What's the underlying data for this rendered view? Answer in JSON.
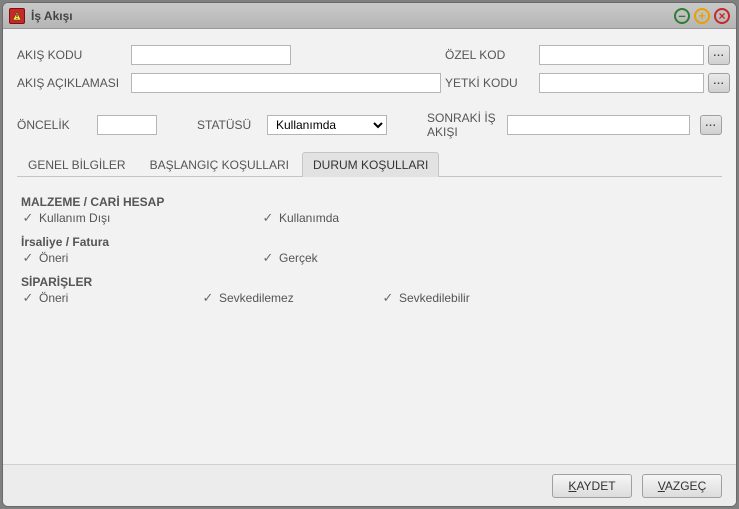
{
  "window": {
    "title": "İş Akışı"
  },
  "fields": {
    "akis_kodu_label": "AKIŞ KODU",
    "akis_kodu_value": "",
    "akis_aciklamasi_label": "AKIŞ AÇIKLAMASI",
    "akis_aciklamasi_value": "",
    "ozel_kod_label": "ÖZEL KOD",
    "ozel_kod_value": "",
    "yetki_kodu_label": "YETKİ KODU",
    "yetki_kodu_value": "",
    "oncelik_label": "ÖNCELİK",
    "oncelik_value": "",
    "statusu_label": "STATÜSÜ",
    "statusu_selected": "Kullanımda",
    "sonraki_label": "SONRAKİ İŞ AKIŞI",
    "sonraki_value": ""
  },
  "tabs": {
    "t0": "GENEL BİLGİLER",
    "t1": "BAŞLANGIÇ KOŞULLARI",
    "t2": "DURUM KOŞULLARI"
  },
  "groups": {
    "malzeme": {
      "title": "MALZEME / CARİ HESAP",
      "kullanim_disi": "Kullanım Dışı",
      "kullanimda": "Kullanımda"
    },
    "irsaliye": {
      "title": "İrsaliye / Fatura",
      "oneri": "Öneri",
      "gercek": "Gerçek"
    },
    "siparisler": {
      "title": "SİPARİŞLER",
      "oneri": "Öneri",
      "sevkedilemez": "Sevkedilemez",
      "sevkedilebilir": "Sevkedilebilir"
    }
  },
  "buttons": {
    "ellipsis": "...",
    "kaydet_pre": "K",
    "kaydet_rest": "AYDET",
    "vazgec_pre": "V",
    "vazgec_rest": "AZGEÇ"
  }
}
